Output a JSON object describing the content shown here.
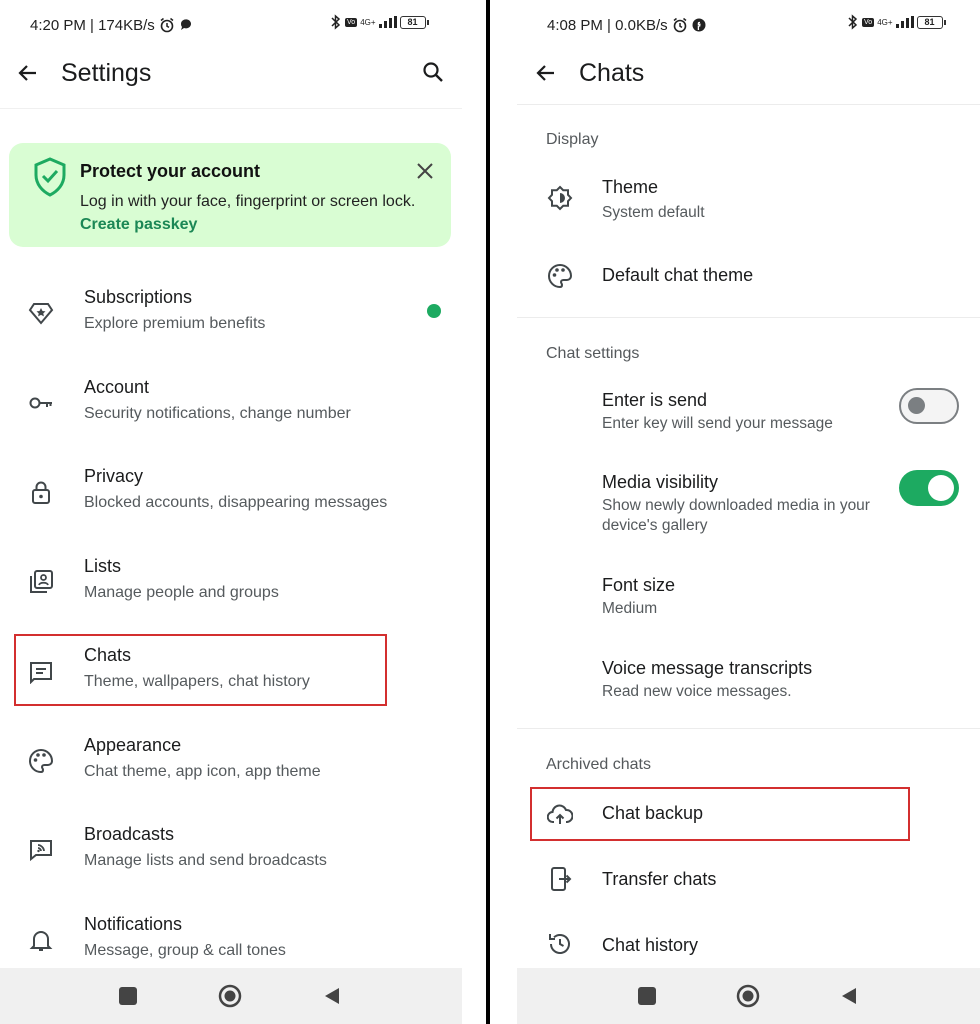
{
  "colors": {
    "accent": "#1daa61",
    "highlight": "#d32f2f",
    "banner_bg": "#d9fdd3",
    "link": "#1b8755"
  },
  "left": {
    "status": {
      "time_speed": "4:20 PM | 174KB/s",
      "battery": "81",
      "network": "4G+"
    },
    "header": {
      "title": "Settings"
    },
    "banner": {
      "title": "Protect your account",
      "text": "Log in with your face, fingerprint or screen lock. ",
      "link": "Create passkey"
    },
    "items": [
      {
        "title": "Subscriptions",
        "subtitle": "Explore premium benefits",
        "icon": "premium-badge-icon"
      },
      {
        "title": "Account",
        "subtitle": "Security notifications, change number",
        "icon": "key-icon"
      },
      {
        "title": "Privacy",
        "subtitle": "Blocked accounts, disappearing messages",
        "icon": "lock-icon"
      },
      {
        "title": "Lists",
        "subtitle": "Manage people and groups",
        "icon": "contacts-list-icon"
      },
      {
        "title": "Chats",
        "subtitle": "Theme, wallpapers, chat history",
        "icon": "chat-icon"
      },
      {
        "title": "Appearance",
        "subtitle": "Chat theme, app icon, app theme",
        "icon": "palette-icon"
      },
      {
        "title": "Broadcasts",
        "subtitle": "Manage lists and send broadcasts",
        "icon": "broadcast-icon"
      },
      {
        "title": "Notifications",
        "subtitle": "Message, group & call tones",
        "icon": "bell-icon"
      }
    ]
  },
  "right": {
    "status": {
      "time_speed": "4:08 PM | 0.0KB/s",
      "battery": "81",
      "network": "4G+"
    },
    "header": {
      "title": "Chats"
    },
    "sections": {
      "display": "Display",
      "chat_settings": "Chat settings",
      "archived": "Archived chats"
    },
    "display_items": [
      {
        "title": "Theme",
        "subtitle": "System default",
        "icon": "theme-icon"
      },
      {
        "title": "Default chat theme",
        "icon": "palette-icon"
      }
    ],
    "chat_settings": [
      {
        "title": "Enter is send",
        "subtitle": "Enter key will send your message",
        "toggle": false
      },
      {
        "title": "Media visibility",
        "subtitle": "Show newly downloaded media in your device's gallery",
        "toggle": true
      },
      {
        "title": "Font size",
        "subtitle": "Medium"
      },
      {
        "title": "Voice message transcripts",
        "subtitle": "Read new voice messages."
      }
    ],
    "archived_items": [
      {
        "title": "Chat backup",
        "icon": "cloud-upload-icon"
      },
      {
        "title": "Transfer chats",
        "icon": "phone-transfer-icon"
      },
      {
        "title": "Chat history",
        "icon": "history-icon"
      }
    ]
  }
}
